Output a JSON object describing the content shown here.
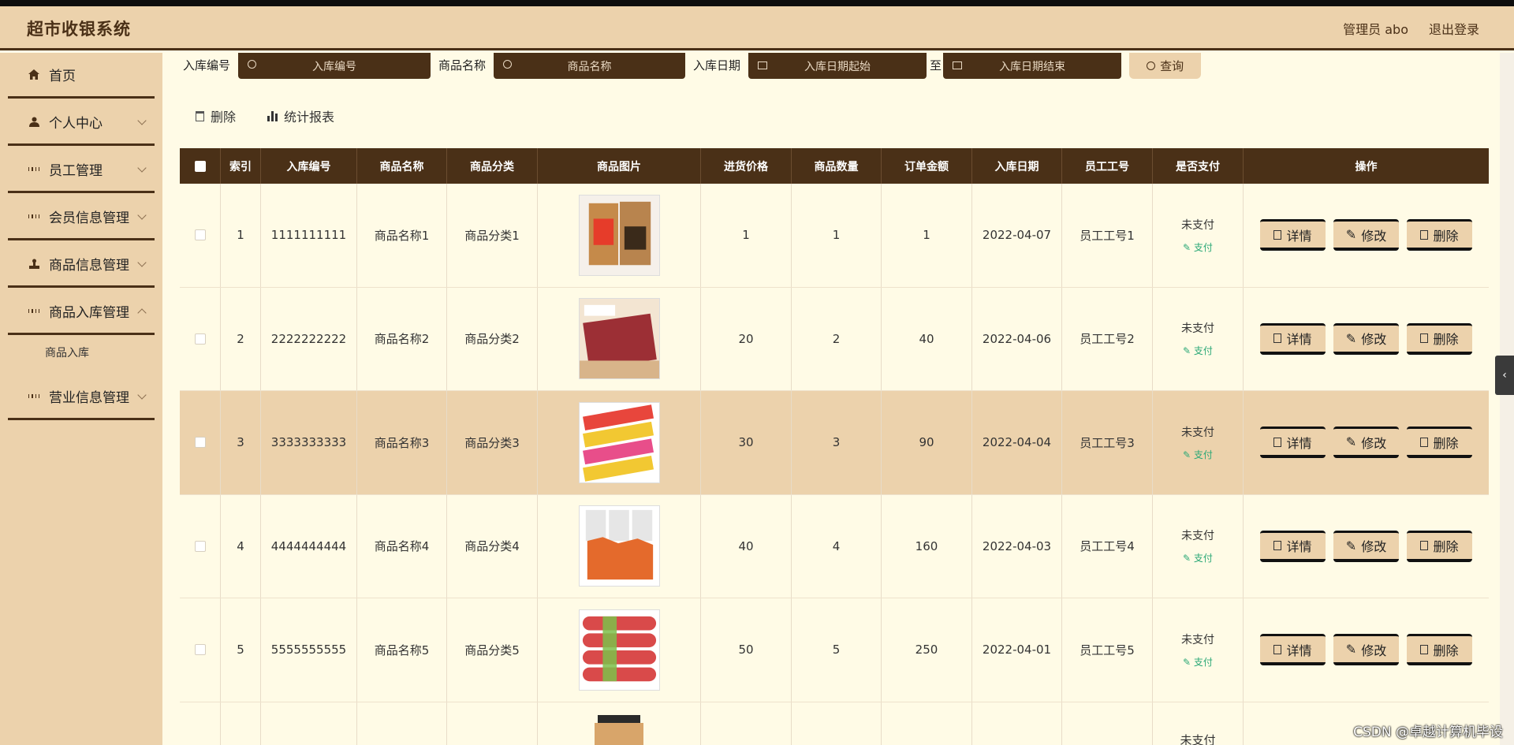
{
  "app": {
    "title": "超市收银系统",
    "admin_label": "管理员 abo",
    "logout_label": "退出登录"
  },
  "sidebar": {
    "items": [
      {
        "label": "首页"
      },
      {
        "label": "个人中心"
      },
      {
        "label": "员工管理"
      },
      {
        "label": "会员信息管理"
      },
      {
        "label": "商品信息管理"
      },
      {
        "label": "商品入库管理"
      },
      {
        "label": "营业信息管理"
      }
    ],
    "submenu_label": "商品入库"
  },
  "search": {
    "label_code": "入库编号",
    "placeholder_code": "入库编号",
    "label_name": "商品名称",
    "placeholder_name": "商品名称",
    "label_date": "入库日期",
    "placeholder_start": "入库日期起始",
    "sep": "至",
    "placeholder_end": "入库日期结束",
    "query_label": "查询"
  },
  "toolbar": {
    "delete_label": "删除",
    "report_label": "统计报表"
  },
  "table": {
    "headers": [
      "索引",
      "入库编号",
      "商品名称",
      "商品分类",
      "商品图片",
      "进货价格",
      "商品数量",
      "订单金额",
      "入库日期",
      "员工工号",
      "是否支付",
      "操作"
    ],
    "rows": [
      {
        "idx": "1",
        "code": "1111111111",
        "name": "商品名称1",
        "cat": "商品分类1",
        "price": "1",
        "qty": "1",
        "amount": "1",
        "date": "2022-04-07",
        "emp": "员工工号1",
        "pay": "未支付",
        "pay_link": "支付"
      },
      {
        "idx": "2",
        "code": "2222222222",
        "name": "商品名称2",
        "cat": "商品分类2",
        "price": "20",
        "qty": "2",
        "amount": "40",
        "date": "2022-04-06",
        "emp": "员工工号2",
        "pay": "未支付",
        "pay_link": "支付"
      },
      {
        "idx": "3",
        "code": "3333333333",
        "name": "商品名称3",
        "cat": "商品分类3",
        "price": "30",
        "qty": "3",
        "amount": "90",
        "date": "2022-04-04",
        "emp": "员工工号3",
        "pay": "未支付",
        "pay_link": "支付"
      },
      {
        "idx": "4",
        "code": "4444444444",
        "name": "商品名称4",
        "cat": "商品分类4",
        "price": "40",
        "qty": "4",
        "amount": "160",
        "date": "2022-04-03",
        "emp": "员工工号4",
        "pay": "未支付",
        "pay_link": "支付"
      },
      {
        "idx": "5",
        "code": "5555555555",
        "name": "商品名称5",
        "cat": "商品分类5",
        "price": "50",
        "qty": "5",
        "amount": "250",
        "date": "2022-04-01",
        "emp": "员工工号5",
        "pay": "未支付",
        "pay_link": "支付"
      },
      {
        "idx": "",
        "code": "",
        "name": "",
        "cat": "",
        "price": "",
        "qty": "",
        "amount": "",
        "date": "",
        "emp": "",
        "pay": "未支付",
        "pay_link": ""
      }
    ],
    "op_detail": "详情",
    "op_edit": "修改",
    "op_delete": "删除"
  },
  "watermark": "CSDN @卓越计算机毕设"
}
